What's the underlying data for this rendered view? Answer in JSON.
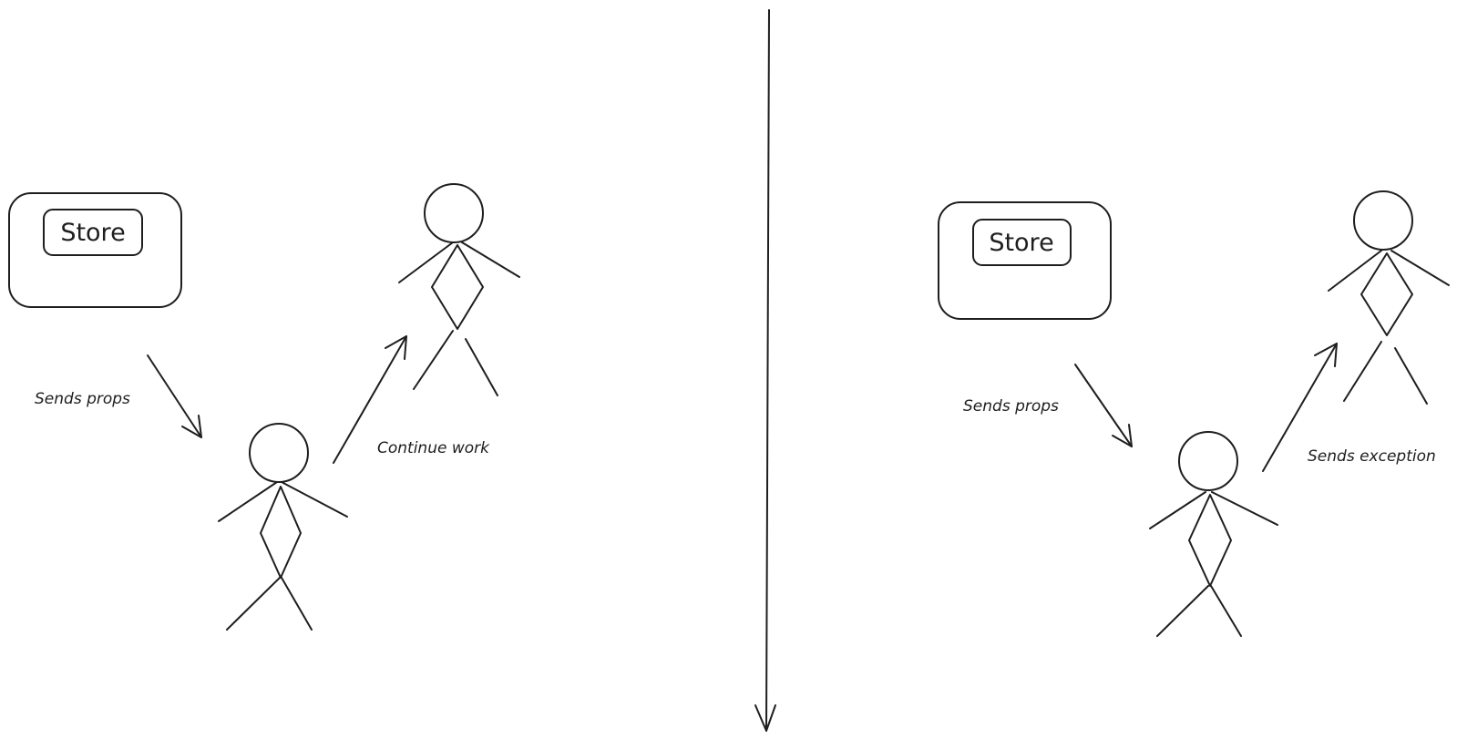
{
  "colors": {
    "ink": "#1e1e1e",
    "store_container": "#b2f2bb",
    "store_badge": "#ffec99",
    "body_ok": "#b2f2bb",
    "body_error": "#ffc9c9"
  },
  "left_scenario": {
    "store_label": "Store",
    "edge_to_component_label": "Sends props",
    "edge_to_parent_label": "Continue work",
    "component_status": "ok"
  },
  "right_scenario": {
    "store_label": "Store",
    "edge_to_component_label": "Sends props",
    "edge_to_parent_label": "Sends exception",
    "component_status": "error"
  }
}
